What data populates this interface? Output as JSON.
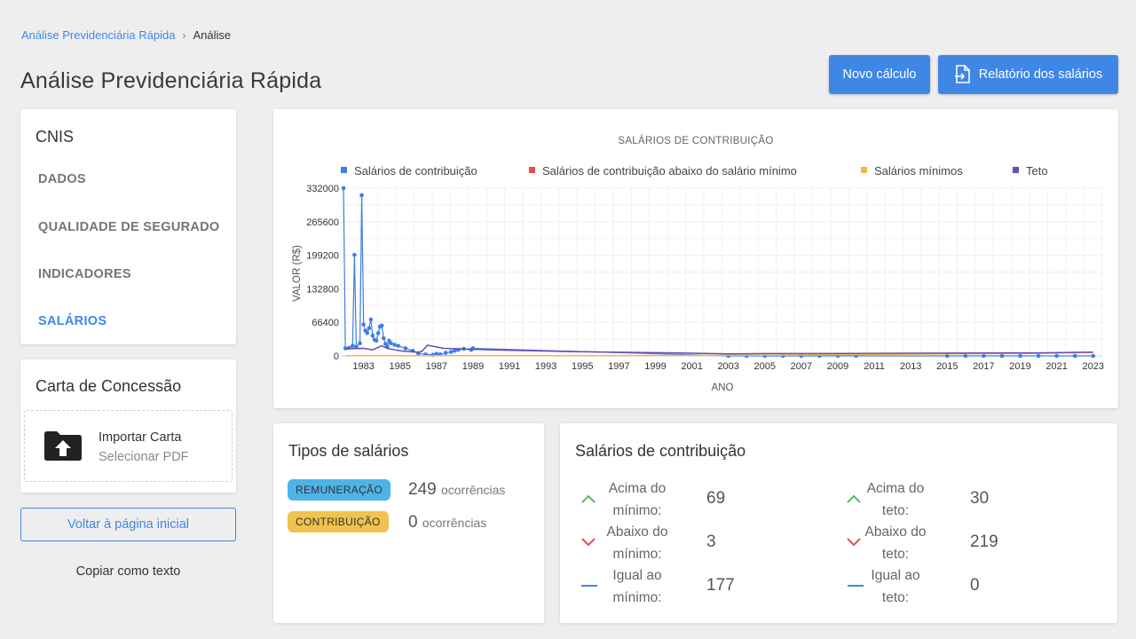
{
  "breadcrumb": {
    "root": "Análise Previdenciária Rápida",
    "separator": "›",
    "current": "Análise"
  },
  "page_title": "Análise Previdenciária Rápida",
  "actions": {
    "novo": "Novo cálculo",
    "relatorio": "Relatório dos salários"
  },
  "cnis": {
    "title": "CNIS",
    "items": [
      "DADOS",
      "QUALIDADE DE SEGURADO",
      "INDICADORES",
      "SALÁRIOS"
    ],
    "active": "SALÁRIOS"
  },
  "carta": {
    "title": "Carta de Concessão",
    "import_title": "Importar Carta",
    "import_sub": "Selecionar PDF"
  },
  "voltar": "Voltar à página inicial",
  "copiar": "Copiar como texto",
  "colors": {
    "accent": "#3f87e6",
    "contrib": "#3f7fe0",
    "below_min": "#e94b4b",
    "min": "#f2b94a",
    "teto": "#6a4bb5",
    "up": "#5cb85c",
    "down": "#d9534f"
  },
  "chart_data": {
    "type": "line",
    "title": "SALÁRIOS DE CONTRIBUIÇÃO",
    "xlabel": "ANO",
    "ylabel": "VALOR (R$)",
    "ylim": [
      0,
      332000
    ],
    "yticks": [
      "332000",
      "265600",
      "199200",
      "132800",
      "66400",
      "0"
    ],
    "xlim": [
      1981.8,
      2023.5
    ],
    "xticks": [
      "1983",
      "1985",
      "1987",
      "1989",
      "1991",
      "1993",
      "1995",
      "1997",
      "1999",
      "2001",
      "2003",
      "2005",
      "2007",
      "2009",
      "2011",
      "2013",
      "2015",
      "2017",
      "2019",
      "2021",
      "2023"
    ],
    "legend_position": "top",
    "grid": true,
    "series": [
      {
        "name": "Salários de contribuição",
        "color": "#3f7fe0",
        "points": [
          [
            1981.9,
            332000
          ],
          [
            1982.0,
            15000
          ],
          [
            1982.2,
            16000
          ],
          [
            1982.4,
            20000
          ],
          [
            1982.5,
            200000
          ],
          [
            1982.6,
            18000
          ],
          [
            1982.8,
            25000
          ],
          [
            1982.9,
            318000
          ],
          [
            1983.0,
            62000
          ],
          [
            1983.1,
            50000
          ],
          [
            1983.2,
            45000
          ],
          [
            1983.3,
            55000
          ],
          [
            1983.4,
            72000
          ],
          [
            1983.5,
            40000
          ],
          [
            1983.6,
            32000
          ],
          [
            1983.7,
            30000
          ],
          [
            1983.8,
            45000
          ],
          [
            1983.9,
            58000
          ],
          [
            1984.0,
            60000
          ],
          [
            1984.1,
            35000
          ],
          [
            1984.2,
            24000
          ],
          [
            1984.3,
            18000
          ],
          [
            1984.4,
            30000
          ],
          [
            1984.5,
            25000
          ],
          [
            1984.7,
            22000
          ],
          [
            1984.9,
            20000
          ],
          [
            1985.3,
            15000
          ],
          [
            1985.7,
            10000
          ],
          [
            1986.0,
            5000
          ],
          [
            1986.4,
            3000
          ],
          [
            1986.8,
            2000
          ],
          [
            1987.0,
            4000
          ],
          [
            1987.2,
            3000
          ],
          [
            1987.5,
            6000
          ],
          [
            1987.8,
            8000
          ],
          [
            1988.0,
            10000
          ],
          [
            1988.2,
            12000
          ],
          [
            1988.5,
            14000
          ],
          [
            1988.9,
            12000
          ],
          [
            1989.0,
            15000
          ],
          [
            2003.0,
            0
          ],
          [
            2004.0,
            0
          ],
          [
            2005.0,
            0
          ],
          [
            2006.0,
            0
          ],
          [
            2007.0,
            0
          ],
          [
            2008.0,
            0
          ],
          [
            2009.0,
            0
          ],
          [
            2010.0,
            0
          ],
          [
            2015.0,
            0
          ],
          [
            2016.0,
            0
          ],
          [
            2017.0,
            0
          ],
          [
            2018.0,
            0
          ],
          [
            2019.0,
            0
          ],
          [
            2020.0,
            0
          ],
          [
            2021.0,
            0
          ],
          [
            2022.0,
            0
          ],
          [
            2023.0,
            0
          ]
        ]
      },
      {
        "name": "Salários de contribuição abaixo do salário mínimo",
        "color": "#e94b4b",
        "points": []
      },
      {
        "name": "Salários mínimos",
        "color": "#f2b94a",
        "points": [
          [
            1982,
            300
          ],
          [
            1990,
            300
          ],
          [
            1995,
            500
          ],
          [
            2000,
            800
          ],
          [
            2005,
            1500
          ],
          [
            2010,
            2500
          ],
          [
            2015,
            4000
          ],
          [
            2020,
            5000
          ],
          [
            2023,
            6500
          ]
        ]
      },
      {
        "name": "Teto",
        "color": "#6a4bb5",
        "points": [
          [
            1982,
            14000
          ],
          [
            1983,
            15000
          ],
          [
            1983.5,
            12000
          ],
          [
            1984,
            20000
          ],
          [
            1984.3,
            15000
          ],
          [
            1984.7,
            12000
          ],
          [
            1985,
            10000
          ],
          [
            1985.3,
            9000
          ],
          [
            1985.7,
            8000
          ],
          [
            1986,
            7000
          ],
          [
            1986.2,
            9000
          ],
          [
            1986.5,
            21000
          ],
          [
            1987.4,
            15000
          ],
          [
            1988.2,
            14000
          ],
          [
            1990,
            12000
          ],
          [
            1995,
            8000
          ],
          [
            2000,
            6000
          ],
          [
            2003,
            4000
          ],
          [
            2005,
            4500
          ],
          [
            2010,
            5000
          ],
          [
            2015,
            5500
          ],
          [
            2020,
            6000
          ],
          [
            2023,
            7500
          ]
        ]
      }
    ]
  },
  "tipos": {
    "title": "Tipos de salários",
    "rows": [
      {
        "badge": "REMUNERAÇÃO",
        "count": "249",
        "label": "ocorrências"
      },
      {
        "badge": "CONTRIBUIÇÃO",
        "count": "0",
        "label": "ocorrências"
      }
    ]
  },
  "salarios": {
    "title": "Salários de contribuição",
    "min": [
      {
        "label": "Acima do mínimo:",
        "value": "69",
        "icon": "chevron-up-icon"
      },
      {
        "label": "Abaixo do mínimo:",
        "value": "3",
        "icon": "chevron-down-icon"
      },
      {
        "label": "Igual ao mínimo:",
        "value": "177",
        "icon": "dash-icon"
      }
    ],
    "teto": [
      {
        "label": "Acima do teto:",
        "value": "30",
        "icon": "chevron-up-icon"
      },
      {
        "label": "Abaixo do teto:",
        "value": "219",
        "icon": "chevron-down-icon"
      },
      {
        "label": "Igual ao teto:",
        "value": "0",
        "icon": "dash-icon"
      }
    ]
  }
}
